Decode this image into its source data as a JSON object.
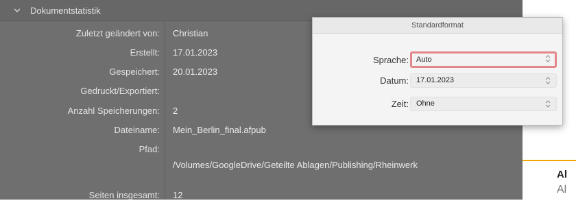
{
  "stats": {
    "title": "Dokumentstatistik",
    "rows": [
      {
        "label": "Zuletzt geändert von:",
        "value": "Christian"
      },
      {
        "label": "Erstellt:",
        "value": "17.01.2023"
      },
      {
        "label": "Gespeichert:",
        "value": "20.01.2023"
      },
      {
        "label": "Gedruckt/Exportiert:",
        "value": ""
      },
      {
        "label": "Anzahl Speicherungen:",
        "value": "2"
      },
      {
        "label": "Dateiname:",
        "value": "Mein_Berlin_final.afpub"
      },
      {
        "label": "Pfad:",
        "value": ""
      },
      {
        "label": "",
        "value": "/Volumes/GoogleDrive/Geteilte Ablagen/Publishing/Rheinwerk"
      },
      {
        "label": "Seiten insgesamt:",
        "value": "12"
      }
    ]
  },
  "format_popover": {
    "title": "Standardformat",
    "fields": [
      {
        "label": "Sprache:",
        "value": "Auto"
      },
      {
        "label": "Datum:",
        "value": "17.01.2023"
      },
      {
        "label": "Zeit:",
        "value": "Ohne"
      }
    ]
  },
  "side": {
    "heading": "Al",
    "text": "Al"
  },
  "colors": {
    "panel_bg": "#6f6f6f",
    "active_field_border": "#e3868a",
    "side_rule": "#f0a500"
  }
}
